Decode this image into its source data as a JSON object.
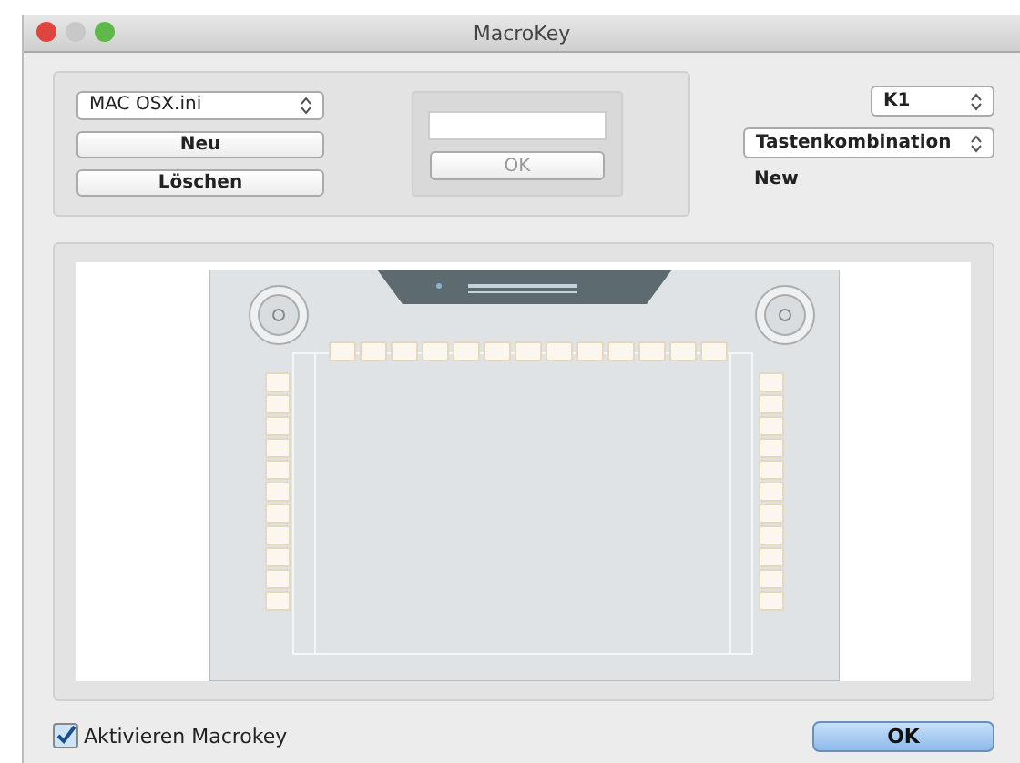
{
  "window": {
    "title": "MacroKey"
  },
  "profile_select": {
    "value": "MAC OSX.ini"
  },
  "buttons": [
    {
      "label": "Neu"
    },
    {
      "label": "Löschen"
    }
  ],
  "name_ok": {
    "label": "OK",
    "disabled": true
  },
  "key_select": {
    "value": "K1"
  },
  "action_select": {
    "value": "Tastenkombination"
  },
  "action_value": "New",
  "activate": {
    "label": "Aktivieren Macrokey",
    "checked": true
  },
  "ok_button": {
    "label": "OK"
  }
}
